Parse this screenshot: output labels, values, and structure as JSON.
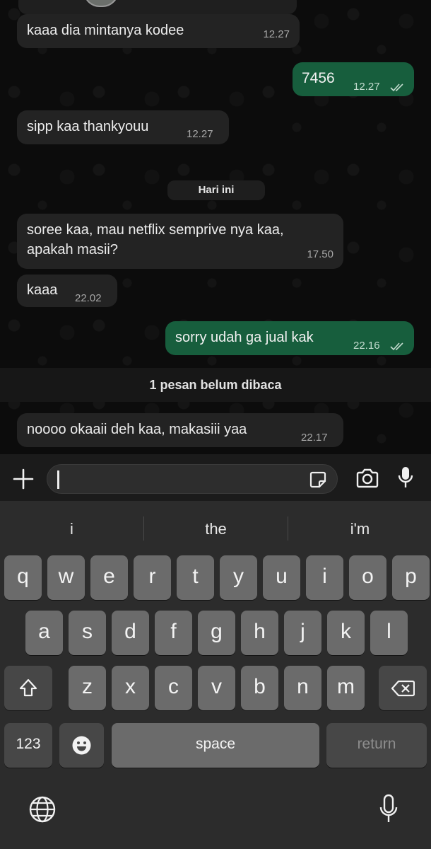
{
  "messages": [
    {
      "text": "kaaa dia mintanya kodee",
      "time": "12.27",
      "dir": "in"
    },
    {
      "text": "7456",
      "time": "12.27",
      "dir": "out",
      "read": true
    },
    {
      "text": "sipp kaa thankyouu",
      "time": "12.27",
      "dir": "in"
    },
    {
      "text_line1": "soree kaa, mau netflix semprive nya kaa,",
      "text_line2": "apakah masii?",
      "time": "17.50",
      "dir": "in"
    },
    {
      "text": "kaaa",
      "time": "22.02",
      "dir": "in"
    },
    {
      "text": "sorry udah ga jual kak",
      "time": "22.16",
      "dir": "out",
      "read": true
    },
    {
      "text": "noooo okaaii deh kaa, makasiii yaa",
      "time": "22.17",
      "dir": "in"
    }
  ],
  "date_divider": "Hari ini",
  "unread_banner": "1 pesan belum dibaca",
  "input": {
    "value": "",
    "placeholder": ""
  },
  "suggestions": [
    "i",
    "the",
    "i'm"
  ],
  "keyboard": {
    "row1": [
      "q",
      "w",
      "e",
      "r",
      "t",
      "y",
      "u",
      "i",
      "o",
      "p"
    ],
    "row2": [
      "a",
      "s",
      "d",
      "f",
      "g",
      "h",
      "j",
      "k",
      "l"
    ],
    "row3": [
      "z",
      "x",
      "c",
      "v",
      "b",
      "n",
      "m"
    ],
    "numbers_label": "123",
    "space_label": "space",
    "return_label": "return"
  },
  "icons": {
    "attach": "plus-icon",
    "sticker": "sticker-icon",
    "camera": "camera-icon",
    "mic": "microphone-icon",
    "emoji": "emoji-icon",
    "globe": "globe-icon",
    "shift": "shift-icon",
    "delete": "delete-icon",
    "read": "double-check-icon"
  },
  "colors": {
    "outgoing_bubble": "#175e3d",
    "incoming_bubble": "#232323",
    "background": "#0c0c0c"
  }
}
